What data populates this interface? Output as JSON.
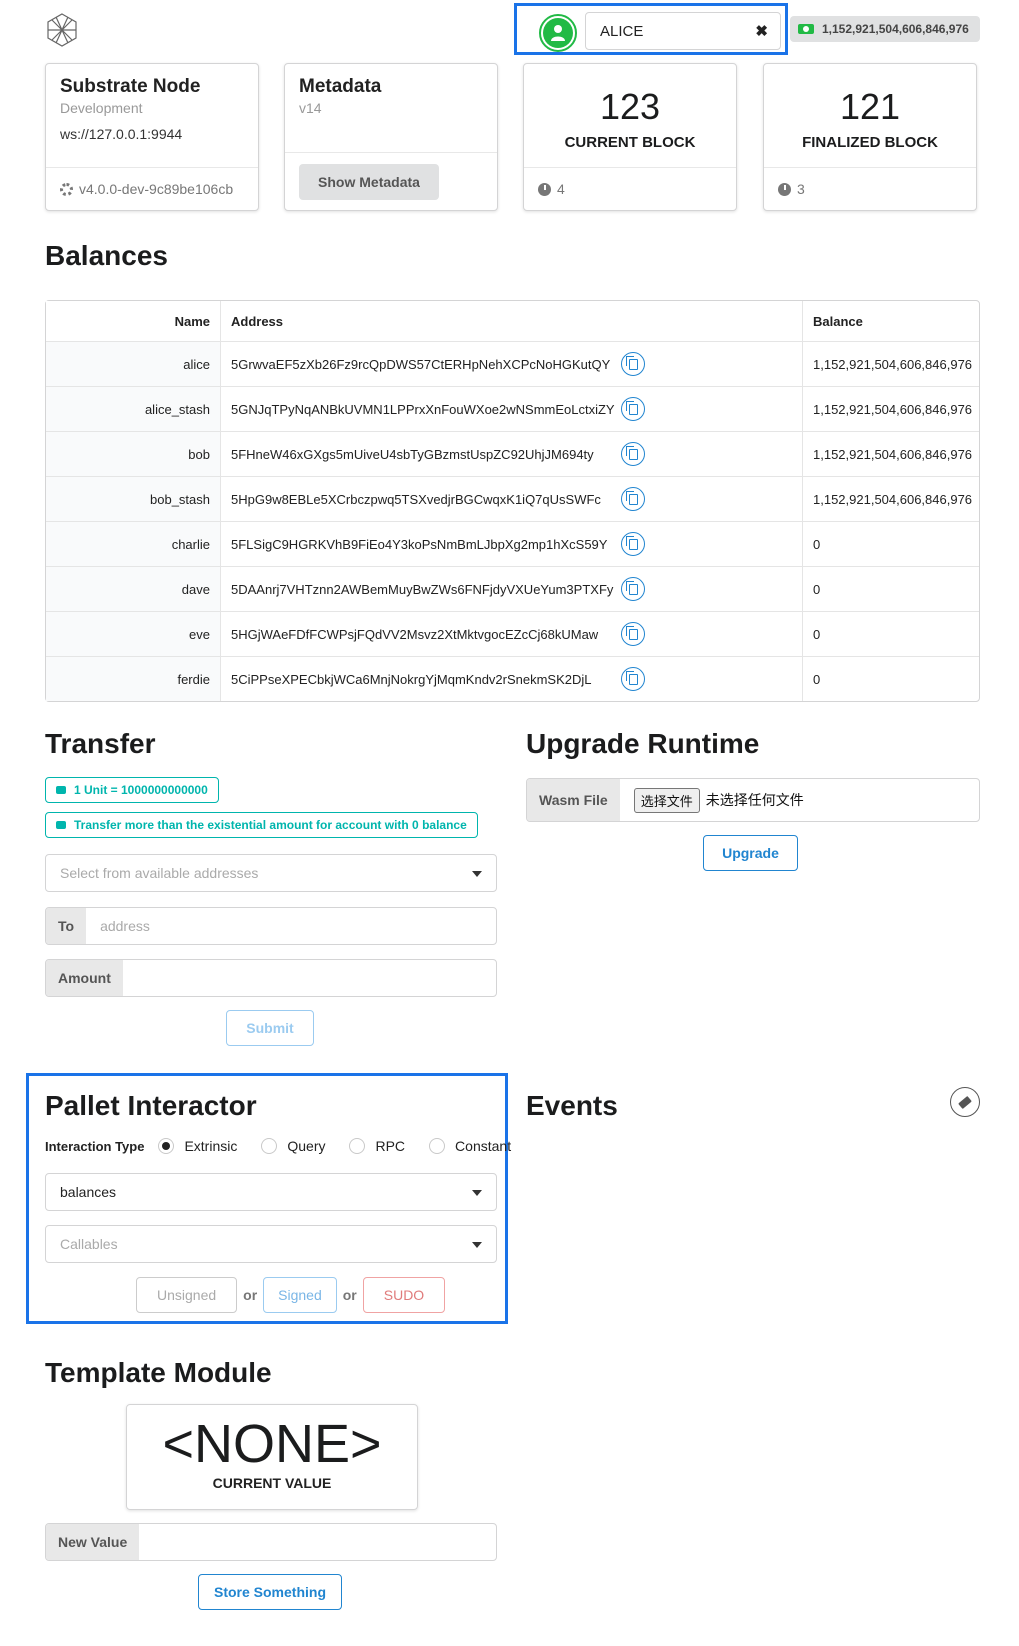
{
  "header": {
    "account_name": "ALICE",
    "balance": "1,152,921,504,606,846,976"
  },
  "node_card": {
    "title": "Substrate Node",
    "meta": "Development",
    "socket": "ws://127.0.0.1:9944",
    "version": "v4.0.0-dev-9c89be106cb"
  },
  "metadata_card": {
    "title": "Metadata",
    "version": "v14",
    "button": "Show Metadata"
  },
  "current_block": {
    "value": "123",
    "label": "CURRENT BLOCK",
    "timer": "4"
  },
  "finalized_block": {
    "value": "121",
    "label": "FINALIZED BLOCK",
    "timer": "3"
  },
  "balances": {
    "title": "Balances",
    "columns": [
      "Name",
      "Address",
      "Balance"
    ],
    "rows": [
      {
        "name": "alice",
        "address": "5GrwvaEF5zXb26Fz9rcQpDWS57CtERHpNehXCPcNoHGKutQY",
        "balance": "1,152,921,504,606,846,976"
      },
      {
        "name": "alice_stash",
        "address": "5GNJqTPyNqANBkUVMN1LPPrxXnFouWXoe2wNSmmEoLctxiZY",
        "balance": "1,152,921,504,606,846,976"
      },
      {
        "name": "bob",
        "address": "5FHneW46xGXgs5mUiveU4sbTyGBzmstUspZC92UhjJM694ty",
        "balance": "1,152,921,504,606,846,976"
      },
      {
        "name": "bob_stash",
        "address": "5HpG9w8EBLe5XCrbczpwq5TSXvedjrBGCwqxK1iQ7qUsSWFc",
        "balance": "1,152,921,504,606,846,976"
      },
      {
        "name": "charlie",
        "address": "5FLSigC9HGRKVhB9FiEo4Y3koPsNmBmLJbpXg2mp1hXcS59Y",
        "balance": "0"
      },
      {
        "name": "dave",
        "address": "5DAAnrj7VHTznn2AWBemMuyBwZWs6FNFjdyVXUeYum3PTXFy",
        "balance": "0"
      },
      {
        "name": "eve",
        "address": "5HGjWAeFDfFCWPsjFQdVV2Msvz2XtMktvgocEZcCj68kUMaw",
        "balance": "0"
      },
      {
        "name": "ferdie",
        "address": "5CiPPseXPECbkjWCa6MnjNokrgYjMqmKndv2rSnekmSK2DjL",
        "balance": "0"
      }
    ]
  },
  "transfer": {
    "title": "Transfer",
    "unit_note": "1 Unit = 1000000000000",
    "existential_note": "Transfer more than the existential amount for account with 0 balance",
    "from_placeholder": "Select from available addresses",
    "to_label": "To",
    "to_placeholder": "address",
    "amount_label": "Amount",
    "submit": "Submit"
  },
  "upgrade": {
    "title": "Upgrade Runtime",
    "wasm_label": "Wasm File",
    "file_button": "选择文件",
    "file_status": "未选择任何文件",
    "button": "Upgrade"
  },
  "pallet": {
    "title": "Pallet Interactor",
    "interaction_label": "Interaction Type",
    "types": [
      "Extrinsic",
      "Query",
      "RPC",
      "Constant"
    ],
    "pallet_value": "balances",
    "callables_placeholder": "Callables",
    "unsigned": "Unsigned",
    "or": "or",
    "signed": "Signed",
    "sudo": "SUDO"
  },
  "events": {
    "title": "Events"
  },
  "template": {
    "title": "Template Module",
    "value": "<NONE>",
    "value_label": "CURRENT VALUE",
    "new_value_label": "New Value",
    "button": "Store Something"
  },
  "colors": {
    "accent": "#2185d0",
    "teal": "#00b5ad",
    "green": "#21ba45",
    "highlight": "#1a73e8",
    "sudo": "#db2828"
  }
}
